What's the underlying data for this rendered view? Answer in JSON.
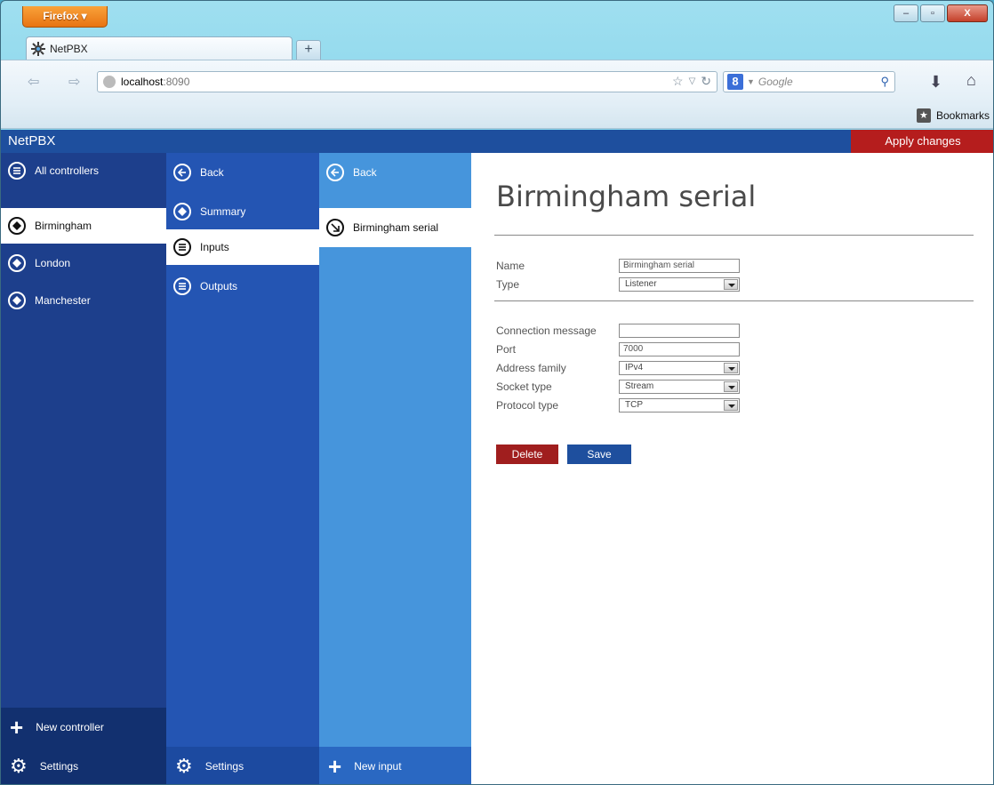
{
  "browser": {
    "menu_button": "Firefox ▾",
    "tab_title": "NetPBX",
    "new_tab": "+",
    "url_host": "localhost",
    "url_port": ":8090",
    "search_placeholder": "Google",
    "bookmarks_label": "Bookmarks",
    "window_controls": [
      "–",
      "▫",
      "X"
    ]
  },
  "app": {
    "title": "NetPBX",
    "apply_label": "Apply changes",
    "accent_blue": "#1e4f9e",
    "accent_red": "#b51d1d"
  },
  "controllers": {
    "all_label": "All controllers",
    "items": [
      {
        "label": "Birmingham",
        "selected": true
      },
      {
        "label": "London",
        "selected": false
      },
      {
        "label": "Manchester",
        "selected": false
      }
    ],
    "new_label": "New controller",
    "settings_label": "Settings"
  },
  "controller_menu": {
    "back_label": "Back",
    "items": [
      {
        "label": "Summary",
        "icon": "diamond-icon",
        "selected": false
      },
      {
        "label": "Inputs",
        "icon": "list-icon",
        "selected": true
      },
      {
        "label": "Outputs",
        "icon": "list-icon",
        "selected": false
      }
    ],
    "settings_label": "Settings"
  },
  "inputs_menu": {
    "back_label": "Back",
    "items": [
      {
        "label": "Birmingham serial",
        "icon": "input-arrow-icon",
        "selected": true
      }
    ],
    "new_label": "New input"
  },
  "form": {
    "title": "Birmingham serial",
    "name_label": "Name",
    "name_value": "Birmingham serial",
    "type_label": "Type",
    "type_value": "Listener",
    "connection_message_label": "Connection message",
    "connection_message_value": "",
    "port_label": "Port",
    "port_value": "7000",
    "address_family_label": "Address family",
    "address_family_value": "IPv4",
    "socket_type_label": "Socket type",
    "socket_type_value": "Stream",
    "protocol_type_label": "Protocol type",
    "protocol_type_value": "TCP",
    "delete_label": "Delete",
    "save_label": "Save"
  }
}
